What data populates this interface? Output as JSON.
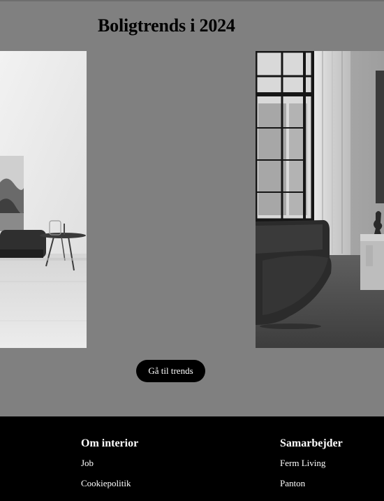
{
  "page": {
    "title": "Boligtrends i 2024"
  },
  "gallery": {
    "images": [
      {
        "name": "interior-photo-left",
        "alt": "",
        "tone": "grayscale"
      },
      {
        "name": "interior-photo-right",
        "alt": "",
        "tone": "grayscale"
      }
    ]
  },
  "cta": {
    "label": "Gå til trends"
  },
  "footer": {
    "columns": [
      {
        "heading": "Om interior",
        "links": [
          "Job",
          "Cookiepolitik"
        ]
      },
      {
        "heading": "Samarbejder",
        "links": [
          "Ferm Living",
          "Panton"
        ]
      }
    ]
  },
  "colors": {
    "page_background": "#808080",
    "button_background": "#000000",
    "footer_background": "#000000",
    "footer_text": "#ffffff"
  }
}
